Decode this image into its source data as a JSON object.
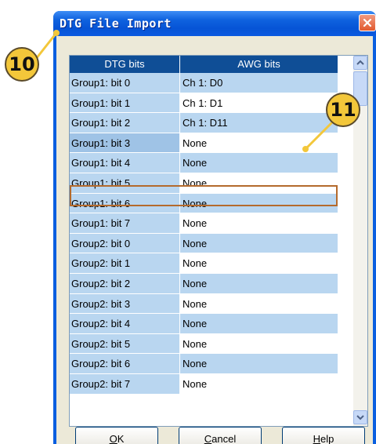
{
  "window": {
    "title": "DTG File Import"
  },
  "colors": {
    "accent": "#0f4e96",
    "callout": "#f3c73a",
    "selection_border": "#b46a2c"
  },
  "table": {
    "columns": [
      "DTG bits",
      "AWG bits"
    ],
    "rows": [
      [
        "Group1: bit 0",
        "Ch 1: D0"
      ],
      [
        "Group1: bit 1",
        "Ch 1: D1"
      ],
      [
        "Group1: bit 2",
        "Ch 1: D11"
      ],
      [
        "Group1: bit 3",
        "None"
      ],
      [
        "Group1: bit 4",
        "None"
      ],
      [
        "Group1: bit 5",
        "None"
      ],
      [
        "Group1: bit 6",
        "None"
      ],
      [
        "Group1: bit 7",
        "None"
      ],
      [
        "Group2: bit 0",
        "None"
      ],
      [
        "Group2: bit 1",
        "None"
      ],
      [
        "Group2: bit 2",
        "None"
      ],
      [
        "Group2: bit 3",
        "None"
      ],
      [
        "Group2: bit 4",
        "None"
      ],
      [
        "Group2: bit 5",
        "None"
      ],
      [
        "Group2: bit 6",
        "None"
      ],
      [
        "Group2: bit 7",
        "None"
      ]
    ],
    "selected_row": 3
  },
  "buttons": {
    "ok": {
      "mnemonic": "O",
      "rest": "K"
    },
    "cancel": {
      "mnemonic": "C",
      "rest": "ancel"
    },
    "help": {
      "mnemonic": "H",
      "rest": "elp"
    }
  },
  "callouts": [
    "10",
    "11"
  ],
  "icons": [
    "close-icon",
    "scroll-up-icon",
    "scroll-down-icon"
  ]
}
